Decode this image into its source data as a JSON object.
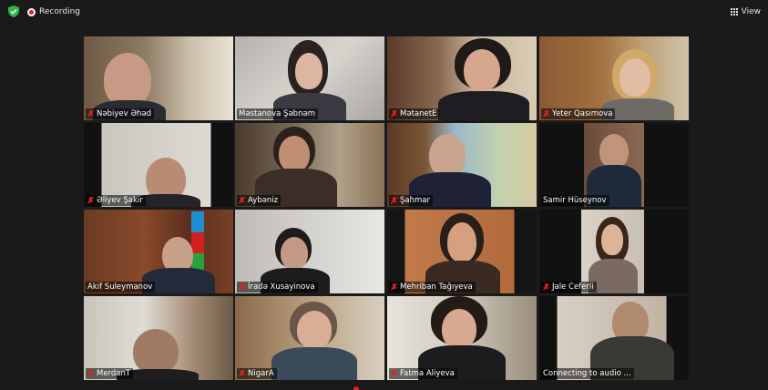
{
  "topbar": {
    "recording_label": "Recording",
    "view_label": "View"
  },
  "participants": [
    {
      "name": "Nəbiyev Əhəd",
      "muted": true
    },
    {
      "name": "Məstanova Şəbnəm",
      "muted": false
    },
    {
      "name": "MətanetE",
      "muted": true
    },
    {
      "name": "Yeter Qasımova",
      "muted": true
    },
    {
      "name": "Əliyev Şakir",
      "muted": true
    },
    {
      "name": "Aybəniz",
      "muted": true
    },
    {
      "name": "Şahmar",
      "muted": true
    },
    {
      "name": "Samir Hüseynov",
      "muted": false
    },
    {
      "name": "Akif Suleymanov",
      "muted": false,
      "active": true
    },
    {
      "name": "İradə Xusayinova",
      "muted": true
    },
    {
      "name": "Mehriban Tağıyeva",
      "muted": true
    },
    {
      "name": "Jale Ceferli",
      "muted": true
    },
    {
      "name": "MerdanT",
      "muted": true
    },
    {
      "name": "NigarA",
      "muted": true
    },
    {
      "name": "Fatma Aliyeva",
      "muted": true
    },
    {
      "name": "Connecting to audio ...",
      "muted": false
    }
  ],
  "colors": {
    "active_speaker_border": "#d7dc3a",
    "muted_icon": "#e02020",
    "shield": "#2fb34a"
  }
}
